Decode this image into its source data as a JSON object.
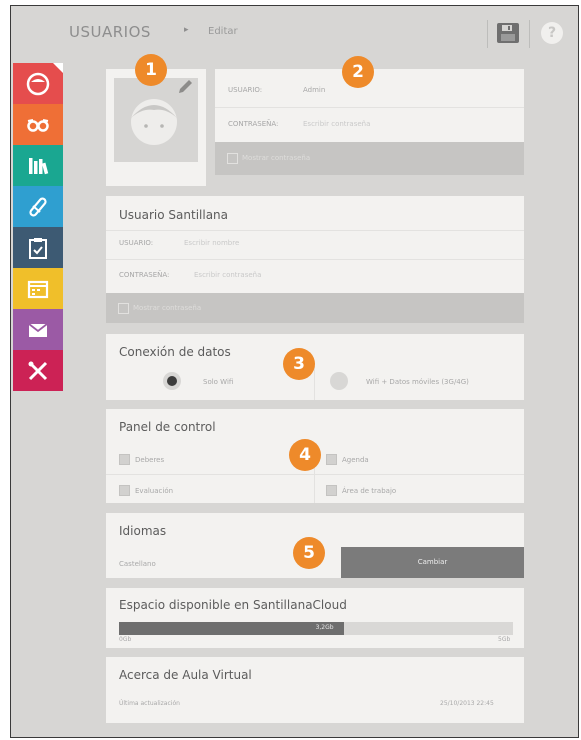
{
  "header": {
    "title": "USUARIOS",
    "separator": "▸",
    "subtitle": "Editar"
  },
  "toolbar": {
    "save_icon": "save-icon",
    "help_label": "?"
  },
  "sidebar": {
    "items": [
      {
        "icon": "avatar-icon",
        "color": "#e54d4d"
      },
      {
        "icon": "glasses-icon",
        "color": "#ef6f36"
      },
      {
        "icon": "books-icon",
        "color": "#1aa791"
      },
      {
        "icon": "pencil-icon",
        "color": "#2f9fd0"
      },
      {
        "icon": "clipboard-icon",
        "color": "#3d5a73"
      },
      {
        "icon": "calendar-icon",
        "color": "#f0bf2a"
      },
      {
        "icon": "mail-icon",
        "color": "#9b5aa5"
      },
      {
        "icon": "tools-icon",
        "color": "#cc2255"
      }
    ]
  },
  "account": {
    "user_label": "USUARIO:",
    "user_value": "Admin",
    "password_label": "CONTRASEÑA:",
    "password_placeholder": "Escribir contraseña",
    "show_password_label": "Mostrar contraseña"
  },
  "santillana": {
    "title": "Usuario Santillana",
    "user_label": "USUARIO:",
    "user_placeholder": "Escribir nombre",
    "password_label": "CONTRASEÑA:",
    "password_placeholder": "Escribir contraseña",
    "show_password_label": "Mostrar contraseña"
  },
  "connection": {
    "title": "Conexión de datos",
    "option_wifi": "Solo Wifi",
    "option_wifi_data": "Wifi + Datos móviles (3G/4G)",
    "selected": "Solo Wifi"
  },
  "control_panel": {
    "title": "Panel de control",
    "items": [
      "Deberes",
      "Agenda",
      "Evaluación",
      "Área de trabajo"
    ]
  },
  "languages": {
    "title": "Idiomas",
    "current": "Castellano",
    "change_button": "Cambiar"
  },
  "storage": {
    "title": "Espacio disponible en SantillanaCloud",
    "used_label": "3,2Gb",
    "min_label": "0Gb",
    "max_label": "5Gb",
    "used_fraction": 0.57
  },
  "about": {
    "title": "Acerca de Aula Virtual",
    "last_update_label": "Última actualización",
    "last_update_value": "25/10/2013 22:45"
  },
  "badges": [
    "1",
    "2",
    "3",
    "4",
    "5"
  ],
  "colors": {
    "accent": "#ee8a2a",
    "panel": "#f3f2f0",
    "background": "#d7d6d4"
  }
}
